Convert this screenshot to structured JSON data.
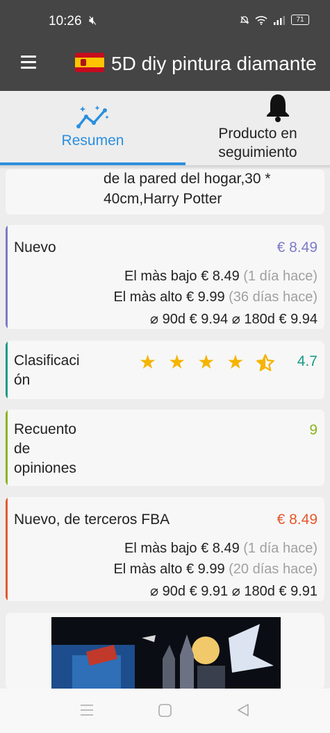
{
  "status_bar": {
    "time": "10:26",
    "battery": "71"
  },
  "app_bar": {
    "title": "5D diy pintura diamante"
  },
  "tabs": [
    {
      "label": "Resumen"
    },
    {
      "label": "Producto en seguimiento"
    }
  ],
  "product": {
    "title_lines": [
      "de la pared del hogar,30 *",
      "40cm,Harry Potter"
    ]
  },
  "new_price": {
    "label": "Nuevo",
    "price": "€ 8.49",
    "lowest_label": "El màs bajo",
    "lowest_value": "€ 8.49",
    "lowest_when": "(1 día hace)",
    "highest_label": "El màs alto",
    "highest_value": "€ 9.99",
    "highest_when": "(36 días hace)",
    "avg_90": "⌀ 90d",
    "avg_90_value": "€ 9.94",
    "avg_180": "⌀ 180d",
    "avg_180_value": "€ 9.94"
  },
  "rating": {
    "label_lines": [
      "Clasificaci",
      "ón"
    ],
    "value": "4.7",
    "stars": 4.5
  },
  "reviews": {
    "label_lines": [
      "Recuento",
      "de",
      "opiniones"
    ],
    "value": "9"
  },
  "fba": {
    "label": "Nuevo, de terceros FBA",
    "price": "€ 8.49",
    "lowest_label": "El màs bajo",
    "lowest_value": "€ 8.49",
    "lowest_when": "(1 día hace)",
    "highest_label": "El màs alto",
    "highest_value": "€ 9.99",
    "highest_when": "(20 días hace)",
    "avg_90": "⌀ 90d",
    "avg_90_value": "€ 9.91",
    "avg_180": "⌀ 180d",
    "avg_180_value": "€ 9.91"
  },
  "colors": {
    "app_bar": "#454545",
    "accent": "#2b8fde",
    "new": "#7c7bc8",
    "rating": "#1a9a86",
    "reviews": "#8bb31c",
    "fba": "#e4582b",
    "star": "#f5b400"
  },
  "icons": [
    "menu-icon",
    "spain-flag-icon",
    "summary-chart-icon",
    "bell-icon",
    "mute-icon",
    "wifi-icon",
    "signal-icon",
    "battery-icon"
  ]
}
